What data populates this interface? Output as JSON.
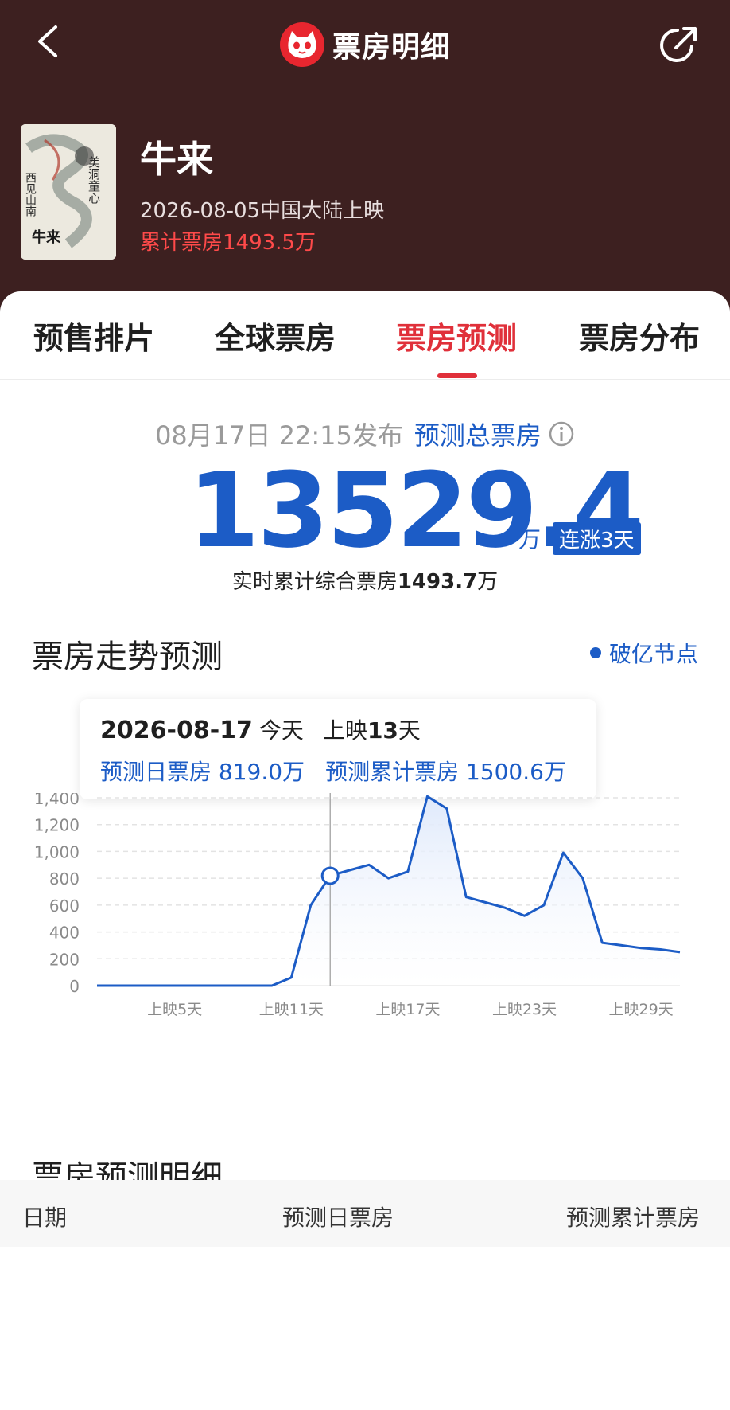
{
  "nav": {
    "title": "票房明细",
    "icons": {
      "back": "chevron-left-icon",
      "share": "share-icon",
      "logo": "maoyan-cat-logo"
    }
  },
  "movie": {
    "title": "牛来",
    "release": "2026-08-05中国大陆上映",
    "cumulative_box_office": "累计票房1493.5万",
    "poster_text": [
      "美洞童心",
      "西见山南",
      "牛来"
    ]
  },
  "tabs": [
    {
      "label": "预售排片",
      "active": false
    },
    {
      "label": "全球票房",
      "active": false
    },
    {
      "label": "票房预测",
      "active": true
    },
    {
      "label": "票房分布",
      "active": false
    }
  ],
  "forecast": {
    "published": "08月17日 22:15发布",
    "label": "预测总票房",
    "total": "13529.4",
    "unit": "万",
    "badge": "连涨3天",
    "realtime_label": "实时累计综合票房",
    "realtime_value": "1493.7",
    "realtime_unit": "万"
  },
  "trend": {
    "title": "票房走势预测",
    "legend": "破亿节点"
  },
  "tooltip": {
    "date": "2026-08-17",
    "today": "今天",
    "day_label": "上映",
    "day_num": "13",
    "day_unit": "天",
    "daily": "预测日票房 819.0万",
    "cumulative": "预测累计票房 1500.6万"
  },
  "chart_data": {
    "type": "area",
    "ylim": [
      0,
      1400
    ],
    "yticks": [
      0,
      200,
      400,
      600,
      800,
      1000,
      1200,
      1400
    ],
    "xtick_labels": [
      {
        "day": 5,
        "label": "上映5天"
      },
      {
        "day": 11,
        "label": "上映11天"
      },
      {
        "day": 17,
        "label": "上映17天"
      },
      {
        "day": 23,
        "label": "上映23天"
      },
      {
        "day": 29,
        "label": "上映29天"
      }
    ],
    "x": [
      1,
      2,
      3,
      4,
      5,
      6,
      7,
      8,
      9,
      10,
      11,
      12,
      13,
      14,
      15,
      16,
      17,
      18,
      19,
      20,
      21,
      22,
      23,
      24,
      25,
      26,
      27,
      28,
      29,
      30,
      31
    ],
    "values": [
      0,
      0,
      0,
      0,
      0,
      0,
      0,
      0,
      0,
      0,
      60,
      600,
      819,
      860,
      900,
      800,
      850,
      1410,
      1320,
      660,
      620,
      580,
      520,
      600,
      990,
      800,
      320,
      300,
      280,
      270,
      250
    ],
    "highlight_day": 13,
    "color": "#1c5cc6",
    "fill": "#dfe9fb",
    "grid": true
  },
  "detail": {
    "title": "票房预测明细",
    "columns": [
      "日期",
      "预测日票房",
      "预测累计票房"
    ]
  }
}
